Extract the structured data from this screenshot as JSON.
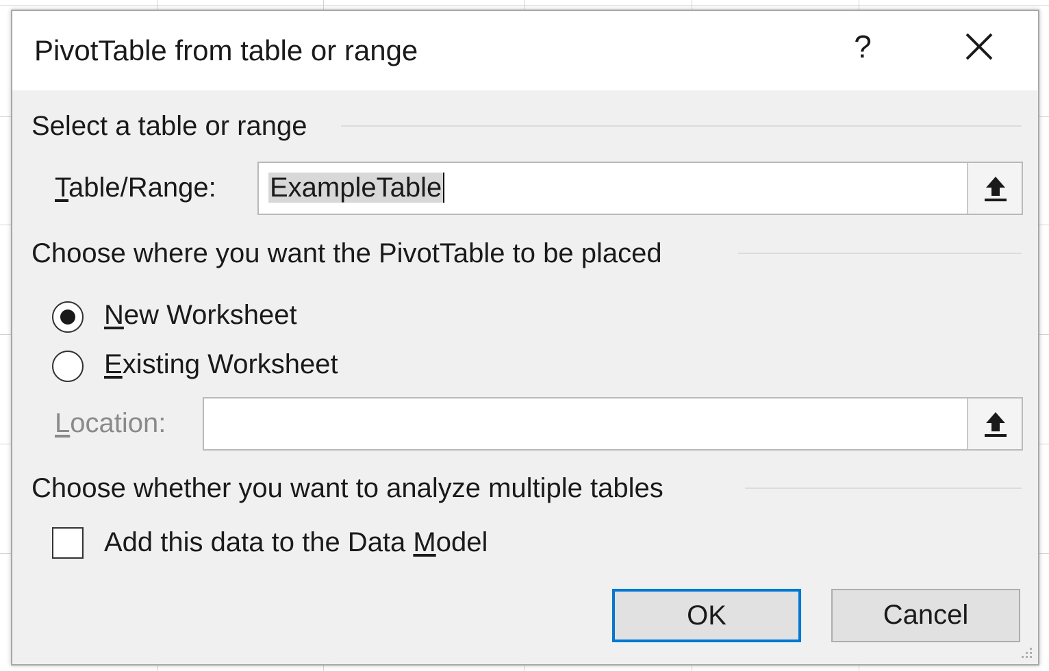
{
  "dialog": {
    "title": "PivotTable from table or range",
    "help_label": "?"
  },
  "select_section": {
    "heading": "Select a table or range",
    "table_range_label_underlined": "T",
    "table_range_label_rest": "able/Range:",
    "table_range_value": "ExampleTable"
  },
  "placement_section": {
    "heading": "Choose where you want the PivotTable to be placed",
    "new_worksheet": {
      "underlined": "N",
      "rest": "ew Worksheet",
      "selected": true
    },
    "existing_worksheet": {
      "underlined": "E",
      "rest": "xisting Worksheet",
      "selected": false
    },
    "location_label_underlined": "L",
    "location_label_rest": "ocation:",
    "location_value": ""
  },
  "multiple_tables_section": {
    "heading": "Choose whether you want to analyze multiple tables",
    "data_model_label_before": "Add this data to the Data ",
    "data_model_label_underlined": "M",
    "data_model_label_after": "odel",
    "data_model_checked": false
  },
  "buttons": {
    "ok": "OK",
    "cancel": "Cancel"
  },
  "colors": {
    "dialog_bg": "#f0f0f0",
    "default_button_border": "#0078d7"
  },
  "icons": {
    "close": "close-icon",
    "collapse": "collapse-dialog-icon",
    "resize": "resize-grip-icon"
  }
}
